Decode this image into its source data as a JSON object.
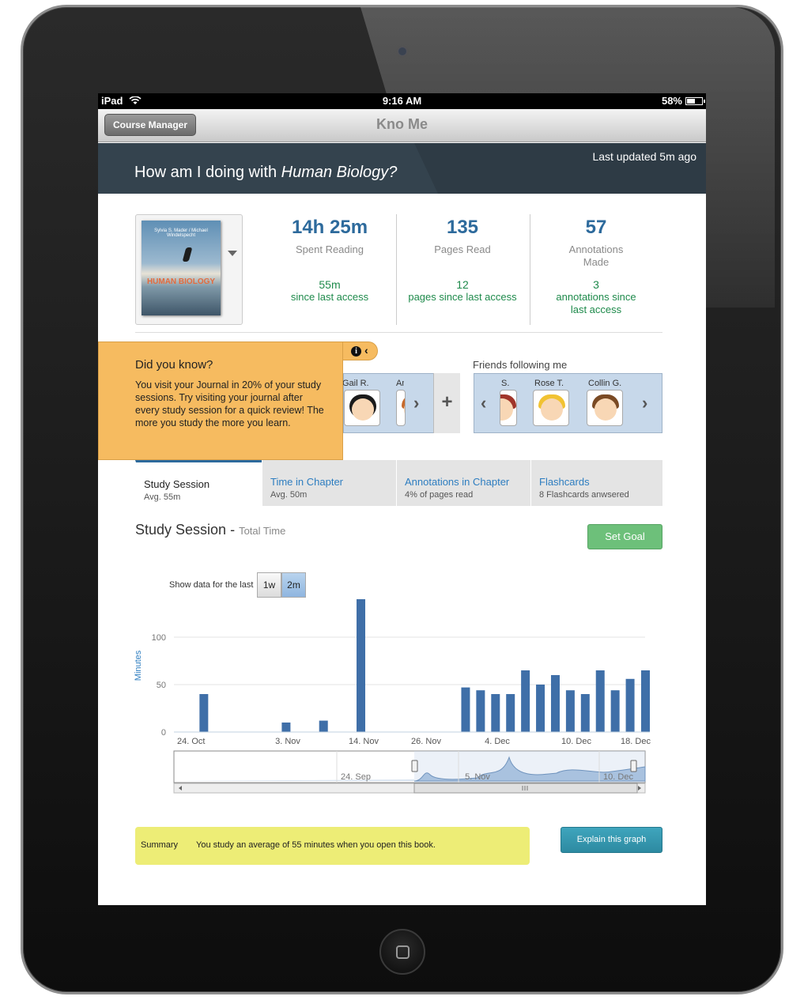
{
  "status_bar": {
    "device": "iPad",
    "time": "9:16 AM",
    "battery": "58%",
    "battery_level": 0.58
  },
  "nav": {
    "back_label": "Course Manager",
    "title": "Kno Me"
  },
  "banner": {
    "question_prefix": "How am I doing with ",
    "book_title": "Human Biology?",
    "last_updated": "Last updated 5m ago"
  },
  "book": {
    "cover_title": "HUMAN BIOLOGY",
    "cover_authors": "Sylvia S. Mader / Michael Windelspecht"
  },
  "stats": [
    {
      "value": "14h 25m",
      "label": "Spent Reading",
      "delta": "55m",
      "delta_label": "since last access"
    },
    {
      "value": "135",
      "label": "Pages Read",
      "delta": "12",
      "delta_label": "pages since last access"
    },
    {
      "value": "57",
      "label": "Annotations Made",
      "delta": "3",
      "delta_label": "annotations since last access"
    }
  ],
  "tip": {
    "title": "Did you know?",
    "body": "You visit your Journal in 20% of your study sessions. Try visiting your journal after every study session for a quick review! The more you study the more you learn."
  },
  "peers": {
    "names": [
      "Gail R.",
      "Am"
    ]
  },
  "friends": {
    "label": "Friends following me",
    "names": [
      "S.",
      "Rose T.",
      "Collin G."
    ]
  },
  "tabs": [
    {
      "label": "Study Session",
      "sub": "Avg. 55m"
    },
    {
      "label": "Time in Chapter",
      "sub": "Avg. 50m"
    },
    {
      "label": "Annotations in Chapter",
      "sub": "4% of pages read"
    },
    {
      "label": "Flashcards",
      "sub": "8 Flashcards anwsered"
    }
  ],
  "section": {
    "title": "Study Session",
    "dash": " - ",
    "subtitle": "Total Time",
    "goal_button": "Set Goal"
  },
  "range": {
    "label": "Show data for the last",
    "options": [
      "1w",
      "2m"
    ],
    "selected": "2m"
  },
  "chart_data": {
    "type": "bar",
    "ylabel": "Minutes",
    "ylim": [
      0,
      140
    ],
    "yticks": [
      0,
      50,
      100
    ],
    "x_ticks": [
      "24. Oct",
      "3. Nov",
      "14. Nov",
      "26. Nov",
      "4. Dec",
      "10. Dec",
      "18. Dec"
    ],
    "x": [
      "2012-10-24",
      "2012-11-04",
      "2012-11-09",
      "2012-11-14",
      "2012-11-28",
      "2012-11-30",
      "2012-12-02",
      "2012-12-04",
      "2012-12-06",
      "2012-12-08",
      "2012-12-10",
      "2012-12-12",
      "2012-12-14",
      "2012-12-16",
      "2012-12-18",
      "2012-12-20"
    ],
    "values": [
      40,
      10,
      12,
      140,
      47,
      44,
      40,
      40,
      65,
      50,
      60,
      44,
      40,
      65,
      44,
      56
    ],
    "trailing_value": 65,
    "navigator_ticks": [
      "24. Sep",
      "5. Nov",
      "10. Dec"
    ]
  },
  "summary": {
    "label": "Summary",
    "text": "You study an average of 55 minutes when you open  this book.",
    "explain_button": "Explain this graph"
  },
  "colors": {
    "accent": "#2d6a9c",
    "bar": "#3f6fa8",
    "tip": "#f6bb60",
    "goal": "#6dc07a",
    "summary": "#eded76",
    "banner": "#2e3b45"
  }
}
